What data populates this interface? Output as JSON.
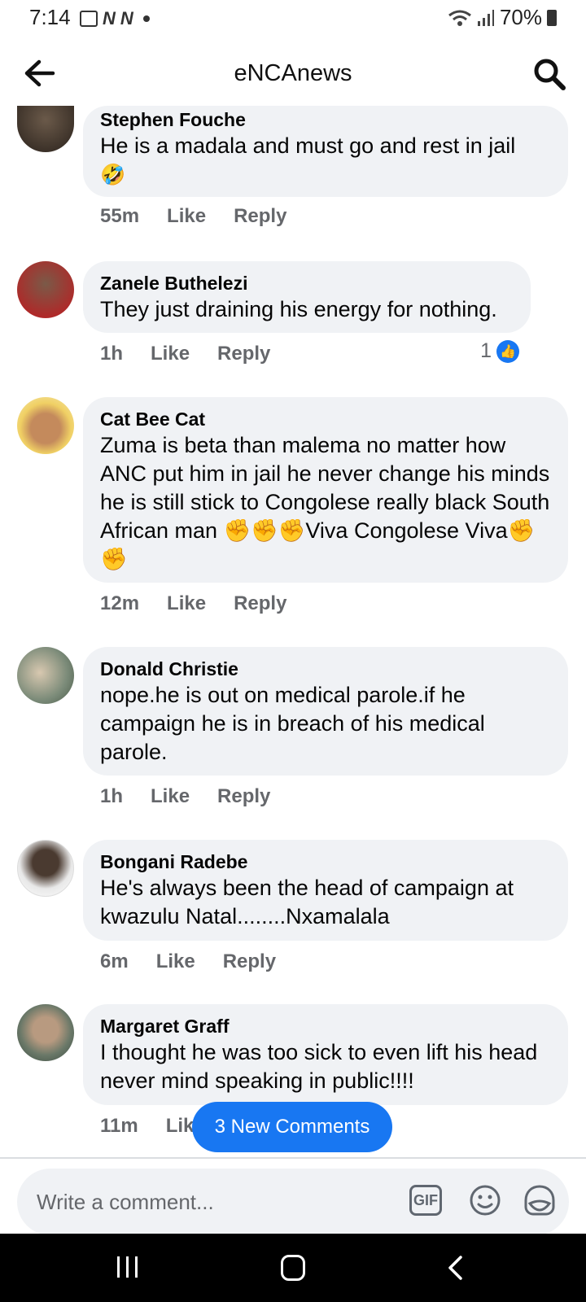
{
  "status_bar": {
    "time": "7:14",
    "battery": "70%"
  },
  "header": {
    "title": "eNCAnews"
  },
  "comments": [
    {
      "author": "Stephen Fouche",
      "text": "He is a madala and must go and rest in jail",
      "emoji": "🤣",
      "time": "55m",
      "like": "Like",
      "reply": "Reply"
    },
    {
      "author": "Zanele Buthelezi",
      "text": "They just draining his energy for nothing.",
      "time": "1h",
      "like": "Like",
      "reply": "Reply",
      "reactions": "1"
    },
    {
      "author": "Cat Bee Cat",
      "text": "Zuma is beta than malema no matter how ANC put him in jail he never change his minds he is still stick to Congolese really black South African man ✊✊✊Viva Congolese Viva✊✊",
      "time": "12m",
      "like": "Like",
      "reply": "Reply"
    },
    {
      "author": "Donald Christie",
      "text": "nope.he is out on medical parole.if he campaign he is in breach of his medical parole.",
      "time": "1h",
      "like": "Like",
      "reply": "Reply"
    },
    {
      "author": "Bongani Radebe",
      "text": "He's always been the head of campaign at kwazulu  Natal........Nxamalala",
      "time": "6m",
      "like": "Like",
      "reply": "Reply"
    },
    {
      "author": "Margaret Graff",
      "text": "I thought he was too sick to even lift his head never mind speaking in public!!!!",
      "time": "11m",
      "like": "Lik"
    }
  ],
  "new_comments_button": "3 New Comments",
  "composer": {
    "placeholder": "Write a comment...",
    "gif_label": "GIF"
  },
  "colors": {
    "accent": "#1877f2",
    "bubble": "#f0f2f5",
    "secondary_text": "#65676b"
  }
}
